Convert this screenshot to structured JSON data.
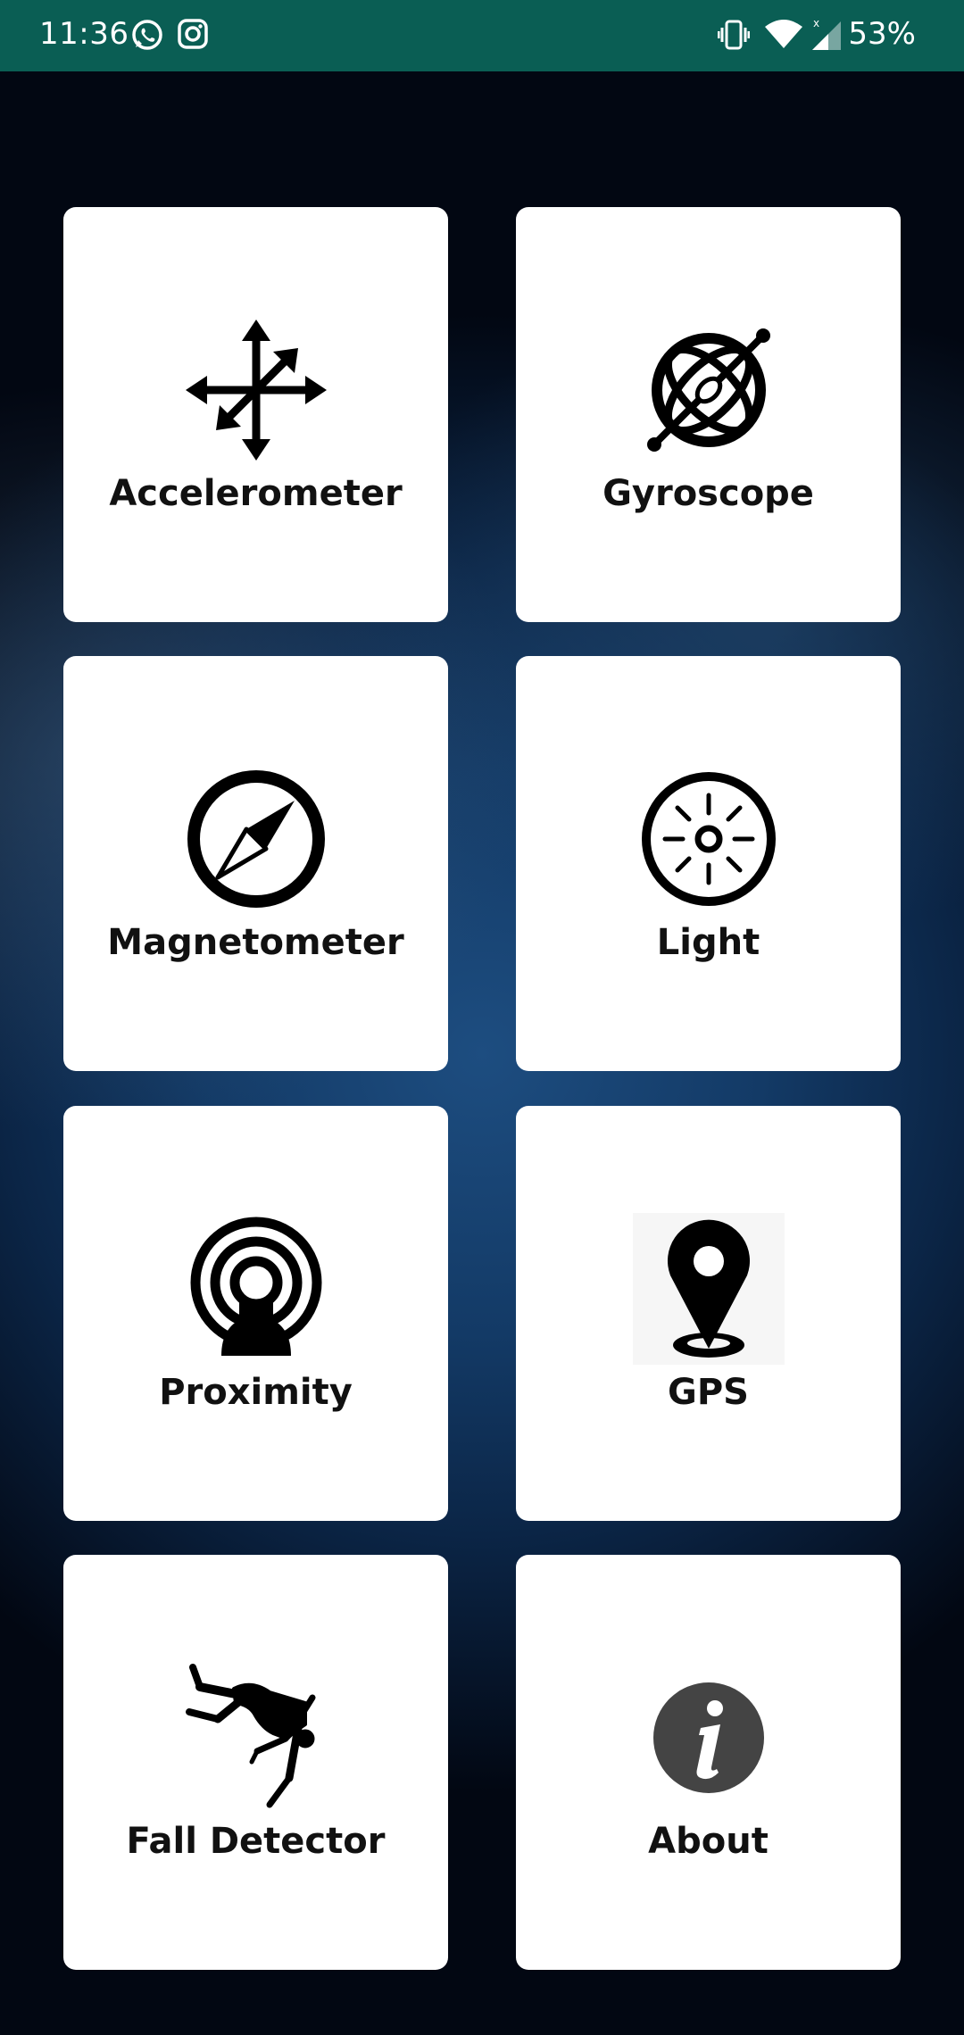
{
  "status_bar": {
    "time": "11:36",
    "battery": "53%",
    "icons": [
      "whatsapp-icon",
      "instagram-icon",
      "vibrate-icon",
      "wifi-icon",
      "signal-icon"
    ]
  },
  "menu": {
    "items": [
      {
        "label": "Accelerometer",
        "icon": "accelerometer-icon"
      },
      {
        "label": "Gyroscope",
        "icon": "gyroscope-icon"
      },
      {
        "label": "Magnetometer",
        "icon": "compass-icon"
      },
      {
        "label": "Light",
        "icon": "light-icon"
      },
      {
        "label": "Proximity",
        "icon": "proximity-icon"
      },
      {
        "label": "GPS",
        "icon": "gps-pin-icon"
      },
      {
        "label": "Fall Detector",
        "icon": "falling-person-icon"
      },
      {
        "label": "About",
        "icon": "info-icon"
      }
    ]
  },
  "colors": {
    "status_bar": "#0a5e54",
    "card": "#ffffff",
    "text": "#111111",
    "about_icon": "#444444"
  }
}
